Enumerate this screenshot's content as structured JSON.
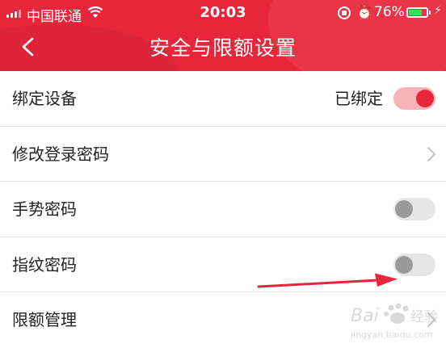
{
  "status_bar": {
    "carrier": "中国联通",
    "time": "20:03",
    "battery_percent": "76%",
    "battery_level": 0.76,
    "signal_icon": "signal-bars-icon",
    "wifi_icon": "wifi-icon"
  },
  "header": {
    "title": "安全与限额设置",
    "back_icon": "chevron-left-icon",
    "background_color": "#e8263b"
  },
  "settings": [
    {
      "label": "绑定设备",
      "value": "已绑定",
      "control": "toggle",
      "on": true
    },
    {
      "label": "修改登录密码",
      "control": "chevron"
    },
    {
      "label": "手势密码",
      "control": "toggle",
      "on": false
    },
    {
      "label": "指纹密码",
      "control": "toggle",
      "on": false
    },
    {
      "label": "限额管理",
      "control": "chevron"
    }
  ],
  "colors": {
    "accent": "#e8263b",
    "toggle_on_track": "#f7b3b7",
    "toggle_off_track": "#e6e6e6",
    "toggle_off_knob": "#9a9a9a",
    "annotation_arrow": "#e8263b"
  },
  "annotation": {
    "icon": "red-arrow-icon",
    "points_to": "指纹密码 toggle"
  },
  "watermark": {
    "text": "Bai 经验",
    "subtext": "jingyan.baidu.com"
  }
}
